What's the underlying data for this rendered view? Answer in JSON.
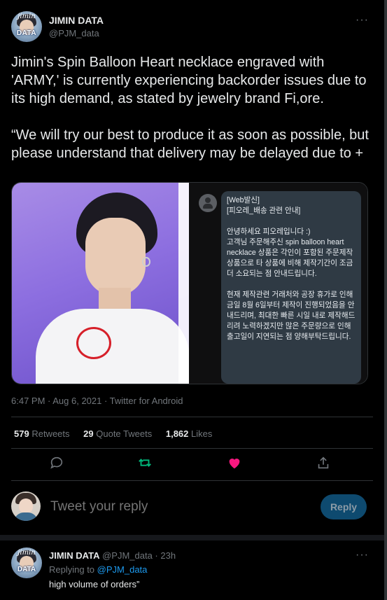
{
  "tweet": {
    "author": {
      "display_name": "JIMIN DATA",
      "handle": "@PJM_data",
      "avatar_label": "DATA",
      "avatar_script": "jimin"
    },
    "more_icon": "more-horizontal-icon",
    "text_paragraphs": [
      "Jimin's Spin Balloon Heart necklace engraved with 'ARMY,' is currently experiencing backorder issues due to its high demand, as stated by jewelry brand Fi,ore.",
      "“We will try our best to produce it as soon as possible, but please understand that delivery may be delayed due to +"
    ],
    "sms_paragraphs": [
      "[Web발신]\n[피오레_배송 관련 안내]",
      "안녕하세요 피오레입니다 :)\n고객님 주문해주신 spin balloon heart necklace 상품은 각인이 포함된 주문제작 상품으로 타 상품에 비해 제작기간이 조금 더 소요되는 점 안내드립니다.",
      "현재 제작관련 거래처와 공장 휴가로 인해 금일 8월 6일부터 제작이 진행되었음을 안내드리며, 최대한 빠른 시일 내로 제작해드리려 노력하겠지만 많은 주문량으로 인해 출고일이 지연되는 점 양해부탁드립니다."
    ],
    "meta": "6:47 PM · Aug 6, 2021 · Twitter for Android",
    "stats": {
      "retweets_count": "579",
      "retweets_label": "Retweets",
      "quotes_count": "29",
      "quotes_label": "Quote Tweets",
      "likes_count": "1,862",
      "likes_label": "Likes"
    },
    "actions": [
      {
        "name": "reply-icon",
        "color": "#71767b"
      },
      {
        "name": "retweet-icon",
        "color": "#00ba7c"
      },
      {
        "name": "like-icon",
        "color": "#f91880"
      },
      {
        "name": "share-icon",
        "color": "#71767b"
      }
    ]
  },
  "composer": {
    "placeholder": "Tweet your reply",
    "button_label": "Reply"
  },
  "reply_tweet": {
    "display_name": "JIMIN DATA",
    "handle_time": "@PJM_data · 23h",
    "replying_prefix": "Replying to",
    "replying_mention": "@PJM_data",
    "text": "high volume of orders”",
    "avatar_label": "DATA",
    "avatar_script": "jimin"
  },
  "colors": {
    "background": "#000000",
    "text": "#e7e9ea",
    "muted": "#71767b",
    "accent": "#1d9bf0",
    "reply_button_bg": "#0e4a6f"
  }
}
